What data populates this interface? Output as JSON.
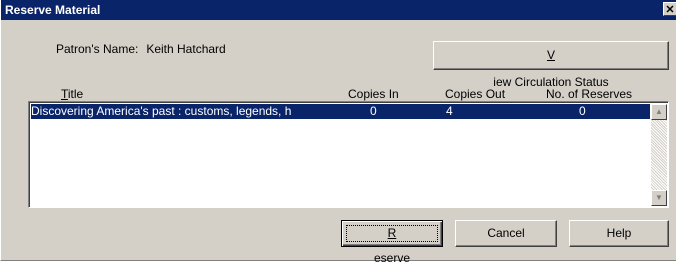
{
  "window": {
    "title": "Reserve Material",
    "close_glyph": "✕"
  },
  "patron": {
    "label": "Patron's Name:",
    "name": "Keith Hatchard"
  },
  "buttons": {
    "view_circulation": {
      "prefix": "",
      "accel": "V",
      "rest": "iew Circulation Status"
    },
    "reserve": {
      "accel": "R",
      "rest": "eserve"
    },
    "cancel": "Cancel",
    "help": "Help"
  },
  "table": {
    "headers": {
      "title": {
        "accel": "T",
        "rest": "itle"
      },
      "copies_in": "Copies In",
      "copies_out": "Copies Out",
      "reserves": "No. of Reserves"
    },
    "rows": [
      {
        "title": "Discovering America's past : customs, legends, h",
        "copies_in": "0",
        "copies_out": "4",
        "reserves": "0",
        "selected": true
      }
    ]
  },
  "scrollbar": {
    "up_icon": "▲",
    "down_icon": "▼"
  },
  "colors": {
    "title_bar": "#0a246a",
    "selection": "#0a246a",
    "face": "#d4d0c8"
  }
}
